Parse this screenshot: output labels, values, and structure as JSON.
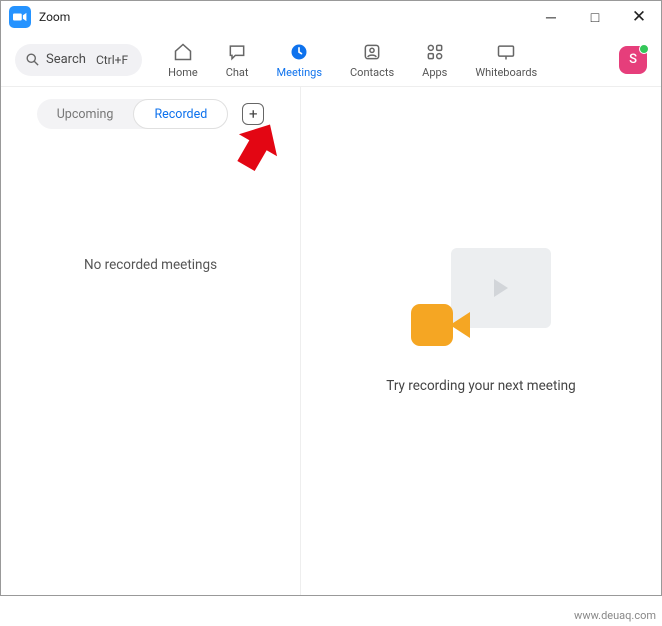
{
  "window": {
    "title": "Zoom"
  },
  "search": {
    "label": "Search",
    "shortcut": "Ctrl+F"
  },
  "nav": {
    "home": "Home",
    "chat": "Chat",
    "meetings": "Meetings",
    "contacts": "Contacts",
    "apps": "Apps",
    "whiteboards": "Whiteboards"
  },
  "avatar": {
    "initial": "S"
  },
  "tabs": {
    "upcoming": "Upcoming",
    "recorded": "Recorded"
  },
  "left": {
    "empty": "No recorded meetings"
  },
  "right": {
    "hint": "Try recording your next meeting"
  },
  "watermark": "www.deuaq.com"
}
